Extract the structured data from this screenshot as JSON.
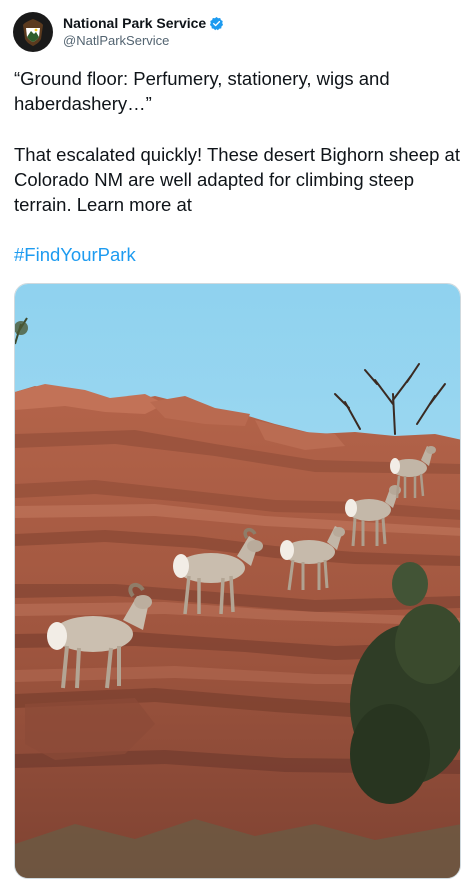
{
  "author": {
    "display_name": "National Park Service",
    "handle": "@NatlParkService",
    "verified": true,
    "avatar_icon": "nps-arrowhead-logo-icon",
    "verified_icon": "verified-badge-icon",
    "verified_color": "#1d9bf0"
  },
  "tweet": {
    "paragraph_1": "“Ground floor: Perfumery, stationery, wigs and haberdashery…”",
    "paragraph_2": "That escalated quickly! These desert Bighorn sheep at Colorado NM are well adapted for climbing steep terrain. Learn more at",
    "hashtag": "#FindYourPark",
    "hashtag_color": "#1d9bf0"
  },
  "media": {
    "image_icon": "bighorn-sheep-photo"
  }
}
